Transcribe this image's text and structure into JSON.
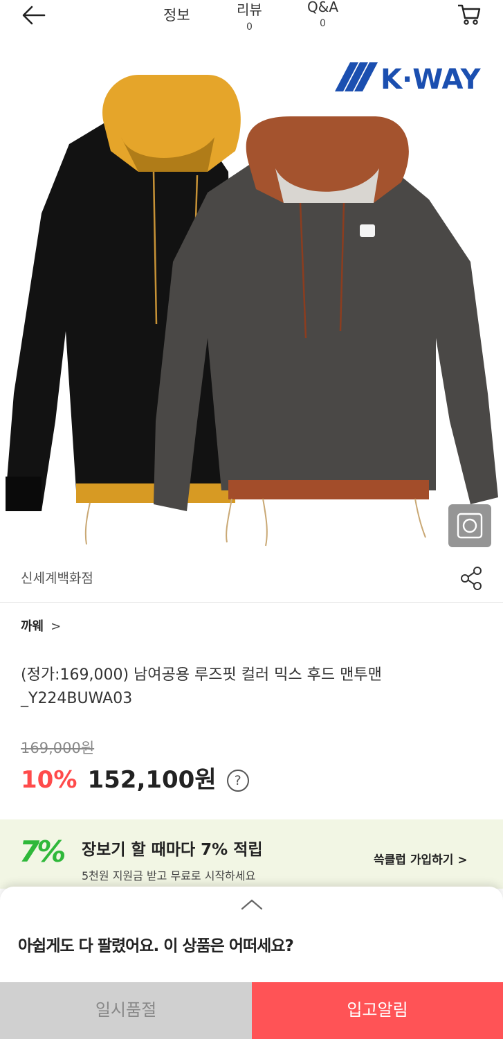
{
  "header": {
    "tabs": [
      {
        "label": "정보",
        "count": ""
      },
      {
        "label": "리뷰",
        "count": "0"
      },
      {
        "label": "Q&A",
        "count": "0"
      }
    ]
  },
  "hero": {
    "brand_logo_text": "K·WAY"
  },
  "store": {
    "name": "신세계백화점"
  },
  "brand": {
    "name": "까웨",
    "chevron": ">"
  },
  "product": {
    "title": "(정가:169,000) 남여공용 루즈핏 컬러 믹스 후드 맨투맨_Y224BUWA03",
    "original_price": "169,000원",
    "discount": "10%",
    "sale_price": "152,100원",
    "help_symbol": "?"
  },
  "promo": {
    "badge": "7%",
    "title": "장보기 할 때마다 7% 적립",
    "subtitle": "5천원 지원금 받고 무료로 시작하세요",
    "link": "쓱클럽 가입하기 >"
  },
  "sheet": {
    "message": "아쉽게도 다 팔렸어요. 이 상품은 어떠세요?"
  },
  "actions": {
    "soldout_label": "일시품절",
    "notify_label": "입고알림"
  },
  "colors": {
    "accent": "#ff5356",
    "discount": "#ff4b4b",
    "promo_bg": "#f2f6e4",
    "promo_green": "#2fb83a",
    "logo_blue": "#1b4fb0"
  }
}
